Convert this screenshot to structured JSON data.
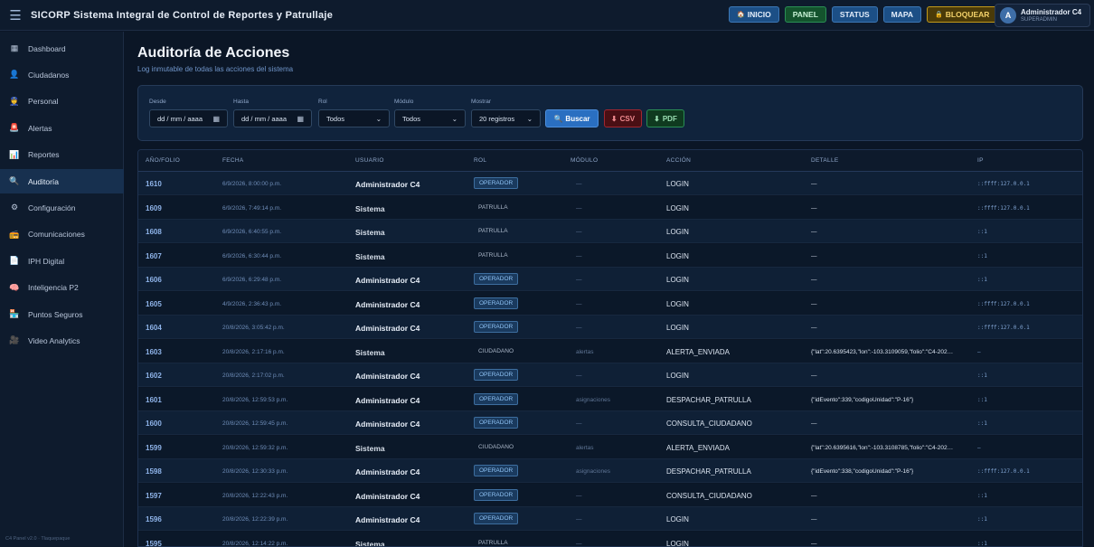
{
  "app": {
    "menu_icon": "hamburger-icon",
    "title": "SICORP Sistema Integral de Control de Reportes y Patrullaje"
  },
  "top_actions": [
    {
      "label": "INICIO",
      "icon": "home-icon",
      "glyph": "🏠",
      "style": "blue"
    },
    {
      "label": "PANEL",
      "icon": "",
      "glyph": "",
      "style": "green"
    },
    {
      "label": "STATUS",
      "icon": "",
      "glyph": "",
      "style": "blue"
    },
    {
      "label": "MAPA",
      "icon": "",
      "glyph": "",
      "style": "blue"
    },
    {
      "label": "BLOQUEAR",
      "icon": "lock-icon",
      "glyph": "🔒",
      "style": "gold"
    }
  ],
  "user": {
    "initial": "A",
    "name": "Administrador C4",
    "role": "SUPERADMIN"
  },
  "sidebar": {
    "items": [
      {
        "label": "Dashboard",
        "icon": "grid-icon",
        "glyph": "▦"
      },
      {
        "label": "Ciudadanos",
        "icon": "citizen-icon",
        "glyph": "👤"
      },
      {
        "label": "Personal",
        "icon": "staff-icon",
        "glyph": "👮"
      },
      {
        "label": "Alertas",
        "icon": "siren-icon",
        "glyph": "🚨"
      },
      {
        "label": "Reportes",
        "icon": "chart-icon",
        "glyph": "📊"
      },
      {
        "label": "Auditoría",
        "icon": "magnifier-icon",
        "glyph": "🔍"
      },
      {
        "label": "Configuración",
        "icon": "gear-icon",
        "glyph": "⚙"
      },
      {
        "label": "Comunicaciones",
        "icon": "radio-icon",
        "glyph": "📻"
      },
      {
        "label": "IPH Digital",
        "icon": "document-icon",
        "glyph": "📄"
      },
      {
        "label": "Inteligencia P2",
        "icon": "brain-icon",
        "glyph": "🧠"
      },
      {
        "label": "Puntos Seguros",
        "icon": "safe-point-icon",
        "glyph": "🏪"
      },
      {
        "label": "Video Analytics",
        "icon": "video-icon",
        "glyph": "🎥"
      }
    ],
    "active_index": 5,
    "footer": "C4 Panel v2.0 · Tlaquepaque"
  },
  "page": {
    "title": "Auditoría de Acciones",
    "subtitle": "Log inmutable de todas las acciones del sistema"
  },
  "filters": {
    "desde_label": "Desde",
    "desde_value": "dd / mm / aaaa",
    "hasta_label": "Hasta",
    "hasta_value": "dd / mm / aaaa",
    "rol_label": "Rol",
    "rol_value": "Todos",
    "modulo_label": "Módulo",
    "modulo_value": "Todos",
    "mostrar_label": "Mostrar",
    "mostrar_value": "20 registros",
    "buscar_label": "Buscar",
    "csv_label": "CSV",
    "pdf_label": "PDF"
  },
  "table": {
    "columns": [
      "AÑO/FOLIO",
      "FECHA",
      "USUARIO",
      "ROL",
      "MÓDULO",
      "ACCIÓN",
      "DETALLE",
      "IP"
    ],
    "rows": [
      {
        "folio": "1610",
        "fecha": "6/9/2026, 8:00:00 p.m.",
        "usuario": "Administrador C4",
        "rol": "OPERADOR",
        "modulo": "—",
        "accion": "LOGIN",
        "detalle": "—",
        "ip": "::ffff:127.0.0.1"
      },
      {
        "folio": "1609",
        "fecha": "6/9/2026, 7:49:14 p.m.",
        "usuario": "Sistema",
        "rol": "PATRULLA",
        "modulo": "—",
        "accion": "LOGIN",
        "detalle": "—",
        "ip": "::ffff:127.0.0.1"
      },
      {
        "folio": "1608",
        "fecha": "6/9/2026, 6:40:55 p.m.",
        "usuario": "Sistema",
        "rol": "PATRULLA",
        "modulo": "—",
        "accion": "LOGIN",
        "detalle": "—",
        "ip": "::1"
      },
      {
        "folio": "1607",
        "fecha": "6/9/2026, 6:30:44 p.m.",
        "usuario": "Sistema",
        "rol": "PATRULLA",
        "modulo": "—",
        "accion": "LOGIN",
        "detalle": "—",
        "ip": "::1"
      },
      {
        "folio": "1606",
        "fecha": "6/9/2026, 6:29:48 p.m.",
        "usuario": "Administrador C4",
        "rol": "OPERADOR",
        "modulo": "—",
        "accion": "LOGIN",
        "detalle": "—",
        "ip": "::1"
      },
      {
        "folio": "1605",
        "fecha": "4/9/2026, 2:36:43 p.m.",
        "usuario": "Administrador C4",
        "rol": "OPERADOR",
        "modulo": "—",
        "accion": "LOGIN",
        "detalle": "—",
        "ip": "::ffff:127.0.0.1"
      },
      {
        "folio": "1604",
        "fecha": "20/8/2026, 3:05:42 p.m.",
        "usuario": "Administrador C4",
        "rol": "OPERADOR",
        "modulo": "—",
        "accion": "LOGIN",
        "detalle": "—",
        "ip": "::ffff:127.0.0.1"
      },
      {
        "folio": "1603",
        "fecha": "20/8/2026, 2:17:16 p.m.",
        "usuario": "Sistema",
        "rol": "CIUDADANO",
        "modulo": "alertas",
        "accion": "ALERTA_ENVIADA",
        "detalle": "{\"lat\":20.6395423,\"lon\":-103.3109059,\"folio\":\"C4-202…",
        "ip": "—"
      },
      {
        "folio": "1602",
        "fecha": "20/8/2026, 2:17:02 p.m.",
        "usuario": "Administrador C4",
        "rol": "OPERADOR",
        "modulo": "—",
        "accion": "LOGIN",
        "detalle": "—",
        "ip": "::1"
      },
      {
        "folio": "1601",
        "fecha": "20/8/2026, 12:59:53 p.m.",
        "usuario": "Administrador C4",
        "rol": "OPERADOR",
        "modulo": "asignaciones",
        "accion": "DESPACHAR_PATRULLA",
        "detalle": "{\"idEvento\":339,\"codigoUnidad\":\"P-16\"}",
        "ip": "::1"
      },
      {
        "folio": "1600",
        "fecha": "20/8/2026, 12:59:45 p.m.",
        "usuario": "Administrador C4",
        "rol": "OPERADOR",
        "modulo": "—",
        "accion": "CONSULTA_CIUDADANO",
        "detalle": "—",
        "ip": "::1"
      },
      {
        "folio": "1599",
        "fecha": "20/8/2026, 12:59:32 p.m.",
        "usuario": "Sistema",
        "rol": "CIUDADANO",
        "modulo": "alertas",
        "accion": "ALERTA_ENVIADA",
        "detalle": "{\"lat\":20.6395616,\"lon\":-103.3108785,\"folio\":\"C4-202…",
        "ip": "—"
      },
      {
        "folio": "1598",
        "fecha": "20/8/2026, 12:30:33 p.m.",
        "usuario": "Administrador C4",
        "rol": "OPERADOR",
        "modulo": "asignaciones",
        "accion": "DESPACHAR_PATRULLA",
        "detalle": "{\"idEvento\":338,\"codigoUnidad\":\"P-16\"}",
        "ip": "::ffff:127.0.0.1"
      },
      {
        "folio": "1597",
        "fecha": "20/8/2026, 12:22:43 p.m.",
        "usuario": "Administrador C4",
        "rol": "OPERADOR",
        "modulo": "—",
        "accion": "CONSULTA_CIUDADANO",
        "detalle": "—",
        "ip": "::1"
      },
      {
        "folio": "1596",
        "fecha": "20/8/2026, 12:22:39 p.m.",
        "usuario": "Administrador C4",
        "rol": "OPERADOR",
        "modulo": "—",
        "accion": "LOGIN",
        "detalle": "—",
        "ip": "::1"
      },
      {
        "folio": "1595",
        "fecha": "20/8/2026, 12:14:22 p.m.",
        "usuario": "Sistema",
        "rol": "PATRULLA",
        "modulo": "—",
        "accion": "LOGIN",
        "detalle": "—",
        "ip": "::1"
      }
    ]
  }
}
